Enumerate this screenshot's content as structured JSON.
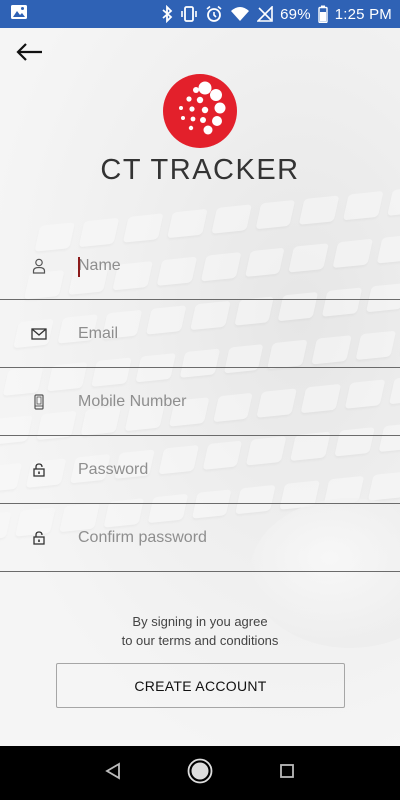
{
  "status_bar": {
    "battery": "69%",
    "time": "1:25 PM"
  },
  "app": {
    "title": "CT TRACKER",
    "brand_color": "#e3202b"
  },
  "form": {
    "name_placeholder": "Name",
    "email_placeholder": "Email",
    "mobile_placeholder": "Mobile Number",
    "password_placeholder": "Password",
    "confirm_placeholder": "Confirm password"
  },
  "terms": {
    "line1": "By signing in you agree",
    "line2": "to our terms and conditions"
  },
  "actions": {
    "create_account_label": "CREATE ACCOUNT"
  },
  "icons": {
    "back": "arrow-left-icon",
    "name": "person-icon",
    "email": "envelope-icon",
    "mobile": "phone-icon",
    "password": "lock-icon",
    "confirm": "lock-icon"
  }
}
